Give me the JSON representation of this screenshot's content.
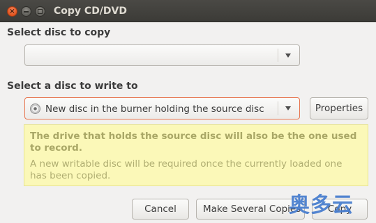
{
  "window": {
    "title": "Copy CD/DVD"
  },
  "source": {
    "label": "Select disc to copy",
    "selected": ""
  },
  "destination": {
    "label": "Select a disc to write to",
    "selected": "New disc in the burner holding the source disc",
    "properties_label": "Properties"
  },
  "info": {
    "primary": "The drive that holds the source disc will also be the one used to record.",
    "secondary": "A new writable disc will be required once the currently loaded one has been copied."
  },
  "actions": {
    "cancel_label": "Cancel",
    "make_several_label": "Make Several Copies",
    "copy_label": "Copy"
  },
  "watermark": {
    "text": "奥多云"
  },
  "colors": {
    "titlebar": "#3c3b37",
    "close_button": "#e2531d",
    "info_background": "#fbf8b8",
    "focus_border": "#e77751"
  }
}
